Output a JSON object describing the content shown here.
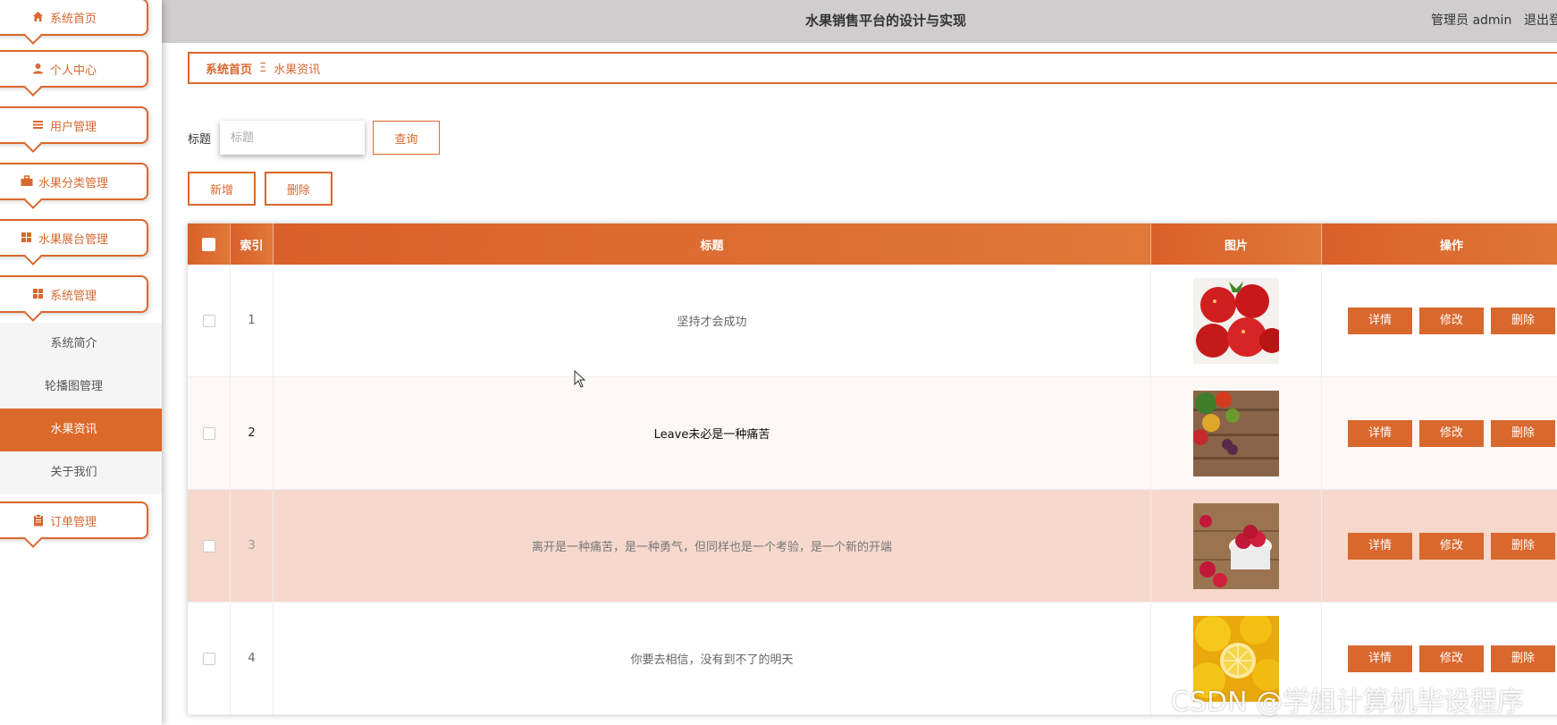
{
  "header": {
    "title": "水果销售平台的设计与实现",
    "user": "管理员 admin",
    "logout": "退出登"
  },
  "sidebar": {
    "items": [
      {
        "label": "系统首页",
        "icon": "home-icon"
      },
      {
        "label": "个人中心",
        "icon": "user-icon"
      },
      {
        "label": "用户管理",
        "icon": "list-icon"
      },
      {
        "label": "水果分类管理",
        "icon": "briefcase-icon"
      },
      {
        "label": "水果展台管理",
        "icon": "grid-icon"
      },
      {
        "label": "系统管理",
        "icon": "grid-icon"
      }
    ],
    "submenu": [
      "系统简介",
      "轮播图管理",
      "水果资讯",
      "关于我们"
    ],
    "active_submenu": "水果资讯",
    "last_item": {
      "label": "订单管理",
      "icon": "clipboard-icon"
    }
  },
  "breadcrumb": {
    "home": "系统首页",
    "separator": "Ξ",
    "current": "水果资讯"
  },
  "search": {
    "label": "标题",
    "placeholder": "标题",
    "value": "",
    "query_button": "查询"
  },
  "actions": {
    "add": "新增",
    "delete": "删除"
  },
  "table": {
    "headers": [
      "索引",
      "标题",
      "图片",
      "操作"
    ],
    "rows": [
      {
        "index": "1",
        "title": "坚持才会成功",
        "image": "strawberries"
      },
      {
        "index": "2",
        "title": "Leave未必是一种痛苦",
        "image": "mixed fruit on wood"
      },
      {
        "index": "3",
        "title": "离开是一种痛苦，是一种勇气，但同样也是一个考验，是一个新的开端",
        "image": "raspberries"
      },
      {
        "index": "4",
        "title": "你要去相信，没有到不了的明天",
        "image": "lemons"
      }
    ],
    "row_buttons": {
      "detail": "详情",
      "edit": "修改",
      "delete": "删除"
    }
  },
  "watermark": "CSDN @学姐计算机毕设程序",
  "colors": {
    "accent": "#d9682e",
    "header_bg": "#cfcdcd",
    "highlight_row": "#f6d8cc"
  }
}
